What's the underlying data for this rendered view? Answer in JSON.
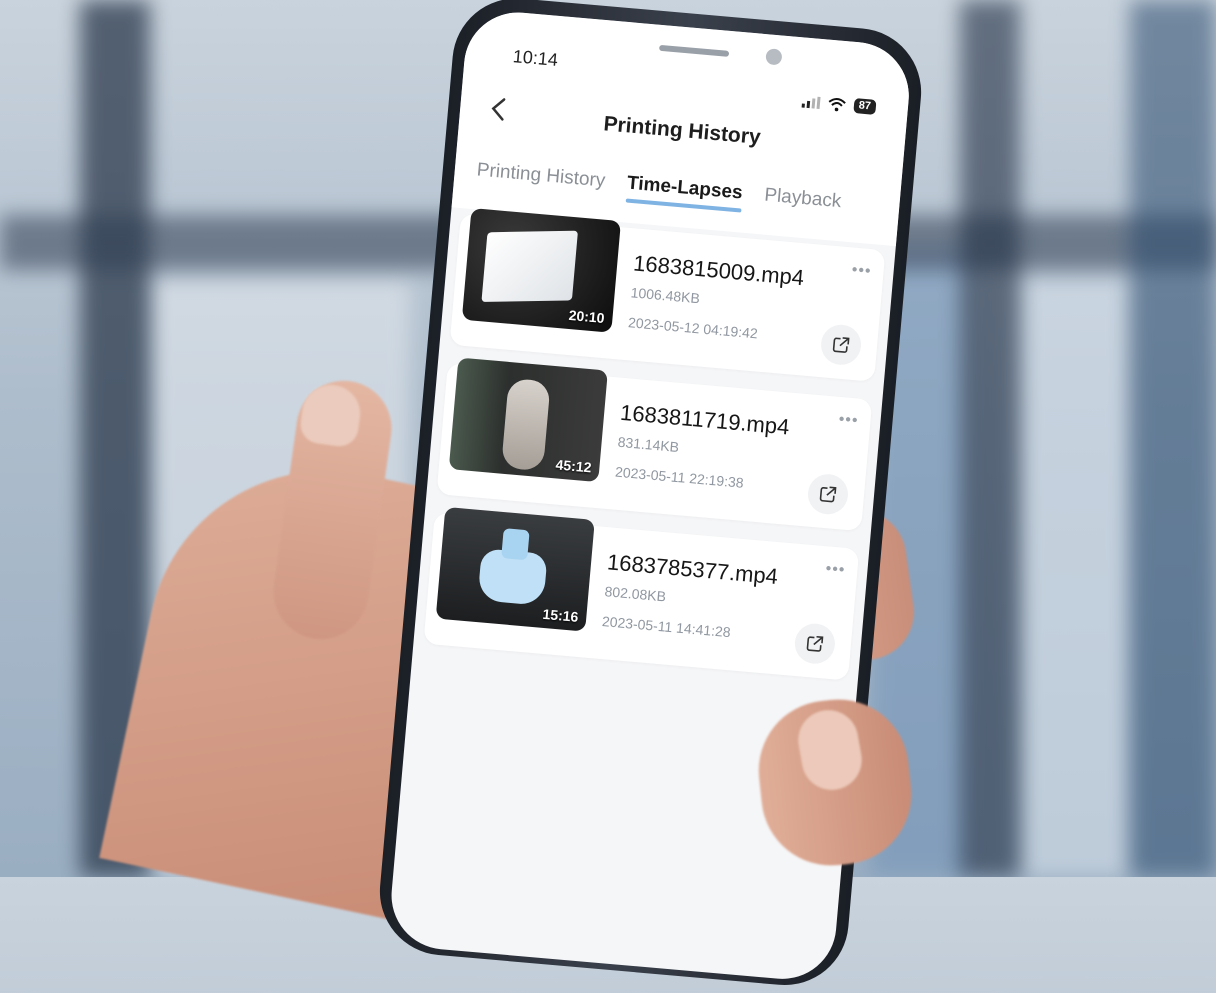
{
  "status_bar": {
    "time": "10:14",
    "battery": "87"
  },
  "nav": {
    "title": "Printing History"
  },
  "tabs": [
    {
      "label": "Printing History"
    },
    {
      "label": "Time-Lapses"
    },
    {
      "label": "Playback"
    }
  ],
  "active_tab": "Time-Lapses",
  "videos": [
    {
      "name": "1683815009.mp4",
      "size": "1006.48KB",
      "date": "2023-05-12 04:19:42",
      "duration": "20:10"
    },
    {
      "name": "1683811719.mp4",
      "size": "831.14KB",
      "date": "2023-05-11 22:19:38",
      "duration": "45:12"
    },
    {
      "name": "1683785377.mp4",
      "size": "802.08KB",
      "date": "2023-05-11 14:41:28",
      "duration": "15:16"
    }
  ],
  "icons": {
    "back": "chevron-left-icon",
    "more": "more-horizontal-icon",
    "share": "share-icon",
    "wifi": "wifi-icon",
    "signal": "cellular-signal-icon"
  },
  "colors": {
    "tab_underline": "#7fb3e3",
    "screen_bg": "#f5f6f8"
  }
}
